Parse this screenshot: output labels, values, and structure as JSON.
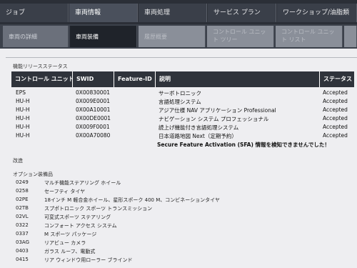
{
  "top_tabs": [
    "ジョブ",
    "車両情報",
    "車両処理",
    "サービス プラン",
    "ワークショップ/油脂類"
  ],
  "sub_tabs": [
    {
      "label": "車両の詳細"
    },
    {
      "label": "車両装備"
    },
    {
      "label": "履歴概要"
    },
    {
      "label": "コントロール ユニット ツリー"
    },
    {
      "label": "コントロール ユニット リスト"
    }
  ],
  "feature_section": {
    "title": "機能リリースステータス",
    "headers": [
      "コントロール ユニット",
      "SWID",
      "Feature-ID",
      "説明",
      "ステータス"
    ],
    "rows": [
      {
        "unit": "EPS",
        "swid": "0X00830001",
        "feature_id": "",
        "description": "サーボトロニック",
        "status": "Accepted"
      },
      {
        "unit": "HU-H",
        "swid": "0X009E0001",
        "feature_id": "",
        "description": "言語処理システム",
        "status": "Accepted"
      },
      {
        "unit": "HU-H",
        "swid": "0X00A10001",
        "feature_id": "",
        "description": "アジア仕様 NAV アプリケーション Professional",
        "status": "Accepted"
      },
      {
        "unit": "HU-H",
        "swid": "0X00DE0001",
        "feature_id": "",
        "description": "ナビゲーション システム プロフェッショナル",
        "status": "Accepted"
      },
      {
        "unit": "HU-H",
        "swid": "0X009F0001",
        "feature_id": "",
        "description": "読上げ機能付き言語処理システム",
        "status": "Accepted"
      },
      {
        "unit": "HU-H",
        "swid": "0X00A70080",
        "feature_id": "",
        "description": "日本道路地図 Next（定期予約）",
        "status": "Accepted"
      }
    ],
    "warning": "Secure Feature Activation (SFA) 情報を検知できませんでした！"
  },
  "modification_title": "改造",
  "options_section": {
    "title": "オプション装備品",
    "items": [
      {
        "code": "0249",
        "desc": "マルチ機能ステアリング ホイール"
      },
      {
        "code": "0258",
        "desc": "セーフティ タイヤ"
      },
      {
        "code": "02PE",
        "desc": "18インチ M 軽合金ホイール、星形スポーク 400 M、コンビネーションタイヤ"
      },
      {
        "code": "02TB",
        "desc": "スプポトロニック スポーツ トランスミッション"
      },
      {
        "code": "02VL",
        "desc": "可変式スポーツ ステアリング"
      },
      {
        "code": "0322",
        "desc": "コンフォート アクセス システム"
      },
      {
        "code": "0337",
        "desc": "M スポーツ パッケージ"
      },
      {
        "code": "03AG",
        "desc": "リアビュー カメラ"
      },
      {
        "code": "0403",
        "desc": "ガラス ルーフ、電動式"
      },
      {
        "code": "0415",
        "desc": "リア ウィンドウ用ローラー ブラインド"
      }
    ]
  }
}
